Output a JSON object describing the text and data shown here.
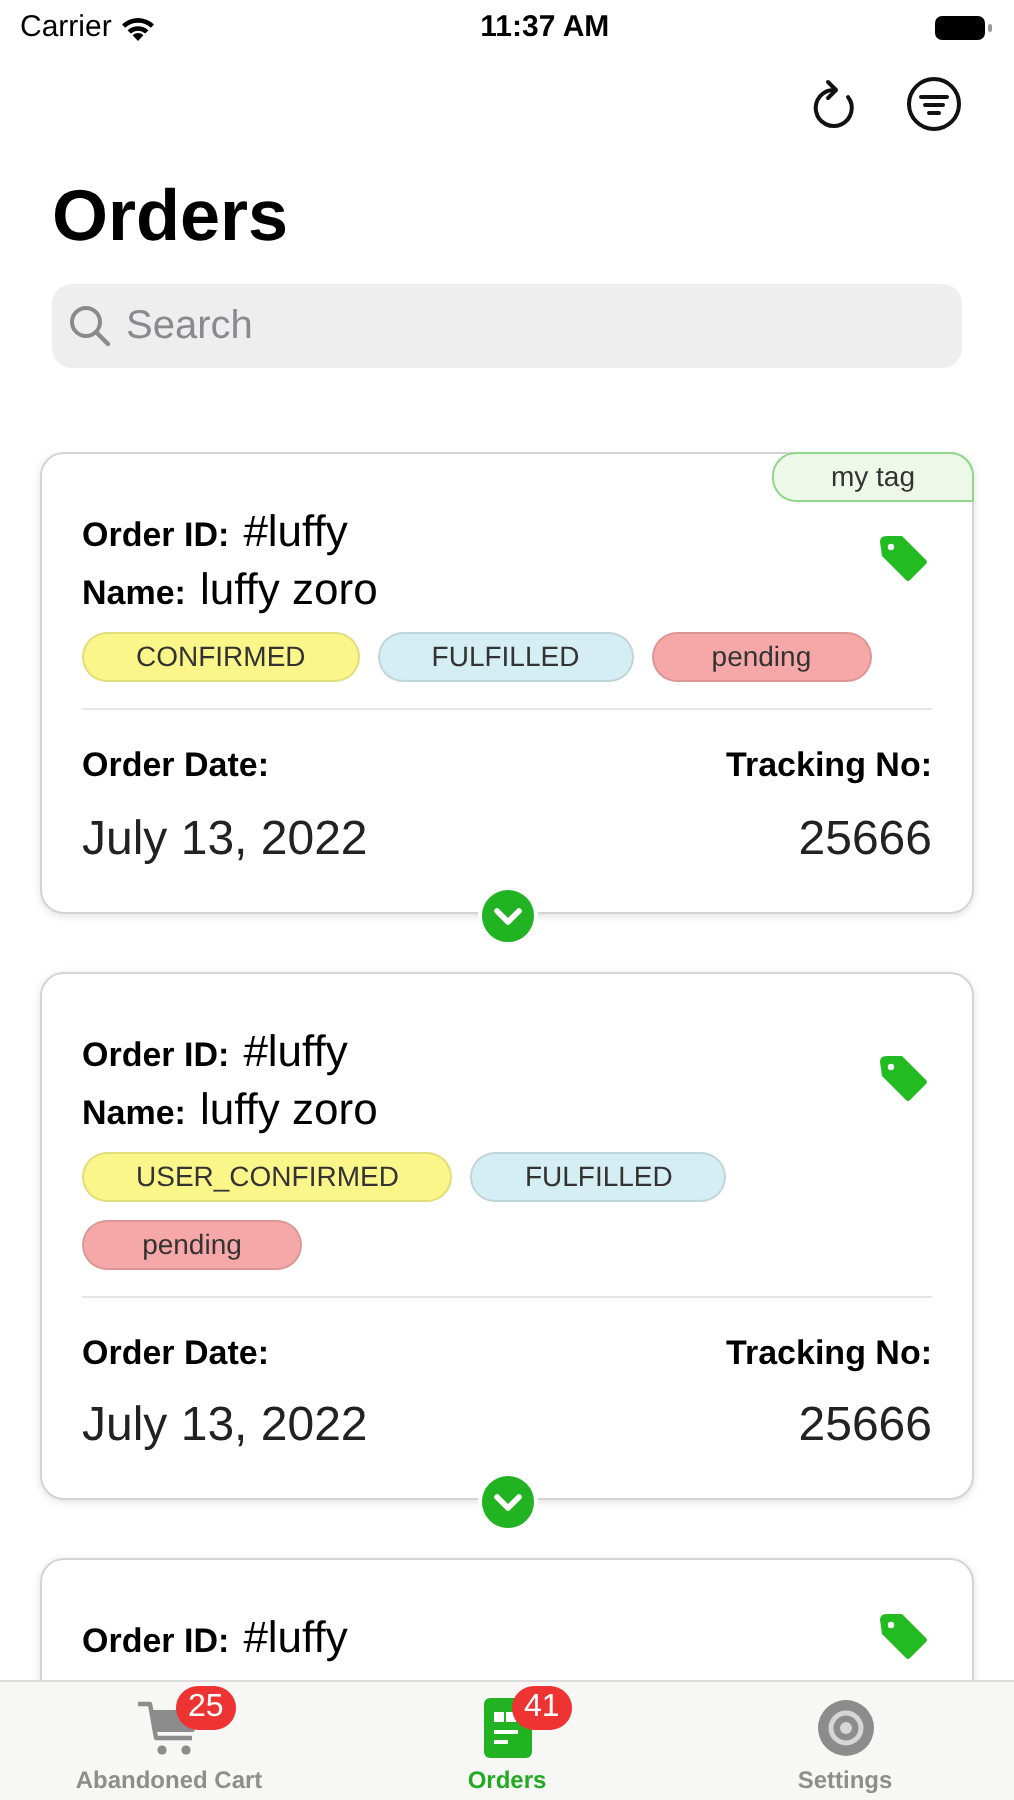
{
  "status_bar": {
    "carrier": "Carrier",
    "time": "11:37 AM"
  },
  "title": "Orders",
  "search": {
    "placeholder": "Search"
  },
  "orders": [
    {
      "tag": "my tag",
      "order_id_label": "Order ID:",
      "order_id": "#luffy",
      "name_label": "Name:",
      "name": "luffy zoro",
      "statuses": [
        {
          "label": "CONFIRMED",
          "color": "#fbf68a"
        },
        {
          "label": "FULFILLED",
          "color": "#d5eef3"
        },
        {
          "label": "pending",
          "color": "#f6a8a8"
        }
      ],
      "date_label": "Order Date:",
      "date": "July 13, 2022",
      "tracking_label": "Tracking No:",
      "tracking": "25666"
    },
    {
      "order_id_label": "Order ID:",
      "order_id": "#luffy",
      "name_label": "Name:",
      "name": "luffy zoro",
      "statuses": [
        {
          "label": "USER_CONFIRMED",
          "color": "#fbf68a"
        },
        {
          "label": "FULFILLED",
          "color": "#d5eef3"
        },
        {
          "label": "pending",
          "color": "#f6a8a8"
        }
      ],
      "date_label": "Order Date:",
      "date": "July 13, 2022",
      "tracking_label": "Tracking No:",
      "tracking": "25666"
    },
    {
      "order_id_label": "Order ID:",
      "order_id": "#luffy"
    }
  ],
  "tabs": [
    {
      "kind": "cart",
      "label": "Abandoned Cart",
      "badge": "25",
      "selected": false
    },
    {
      "kind": "orders",
      "label": "Orders",
      "badge": "41",
      "selected": true
    },
    {
      "kind": "settings",
      "label": "Settings",
      "selected": false
    }
  ]
}
